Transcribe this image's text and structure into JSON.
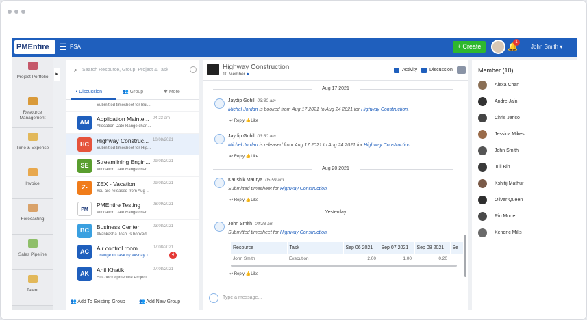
{
  "header": {
    "logo": "PMEntire",
    "module": "PSA",
    "create_label": "+ Create",
    "notification_count": "1",
    "user_name": "John Smith"
  },
  "nav": [
    {
      "label": "Project Portfolio"
    },
    {
      "label": "Resource Management"
    },
    {
      "label": "Time & Expense"
    },
    {
      "label": "Invoice"
    },
    {
      "label": "Forecasting"
    },
    {
      "label": "Sales Pipeline"
    },
    {
      "label": "Talent"
    }
  ],
  "list": {
    "search_placeholder": "Search Resource, Group, Project & Task",
    "tabs": [
      "Discussion",
      "Group",
      "More"
    ],
    "partial_preview": "Submitted timesheet for Bui...",
    "items": [
      {
        "initials": "AM",
        "name": "Application Mainte...",
        "date": "04:23 am",
        "preview": "Allocation Date Range chan...",
        "color": "#1f5fbd"
      },
      {
        "initials": "HC",
        "name": "Highway Construc...",
        "date": "10/08/2021",
        "preview": "Submitted timesheet for Hig...",
        "color": "#e5533c"
      },
      {
        "initials": "SE",
        "name": "Streamlining Engin...",
        "date": "09/08/2021",
        "preview": "Allocation Date Range chan...",
        "color": "#5a9e2f"
      },
      {
        "initials": "Z-",
        "name": "ZEX - Vacation",
        "date": "09/08/2021",
        "preview": "You are released from Aug ...",
        "color": "#f07c1a"
      },
      {
        "initials": "PM",
        "name": "PMEntire Testing",
        "date": "08/09/2021",
        "preview": "Allocation Date Range chan...",
        "color": "#1f3b7a"
      },
      {
        "initials": "BC",
        "name": "Business Center",
        "date": "03/08/2021",
        "preview": "Akankasha Joshi is booked ...",
        "color": "#3aa0e0"
      },
      {
        "initials": "AC",
        "name": "Air control room",
        "date": "07/08/2021",
        "preview": "Change In Task by Akshay T...",
        "color": "#1f5fbd",
        "badge": "4"
      },
      {
        "initials": "AK",
        "name": "Anil Khatik",
        "date": "07/08/2021",
        "preview": "Hi Check #pmentire Project ...",
        "color": "#1f5fbd"
      }
    ],
    "footer_add_existing": "Add To Existing Group",
    "footer_add_new": "Add New Group"
  },
  "chat": {
    "title": "Highway Construction",
    "subtitle": "10 Member",
    "activity_label": "Activity",
    "discussion_label": "Discussion",
    "top_date": "Aug 17 2021",
    "date2": "Aug 20 2021",
    "date3": "Yesterday",
    "messages": [
      {
        "name": "Jaydip Gohil",
        "time": "03:30 am",
        "who": "Michel Jordan",
        "mid": " is booked from Aug 17 2021 to Aug 24 2021 for ",
        "proj": "Highway Construction",
        "end": "."
      },
      {
        "name": "Jaydip Gohil",
        "time": "03:30 am",
        "who": "Michel Jordan",
        "mid": " is released from Aug 17 2021 to Aug 24 2021 for ",
        "proj": "Highway Construction",
        "end": "."
      },
      {
        "name": "Kaushik Maurya",
        "time": "05:59 am",
        "who": "",
        "mid": "Submitted timesheet for ",
        "proj": "Highway Construction",
        "end": "."
      },
      {
        "name": "John Smith",
        "time": "04:23 am",
        "who": "",
        "mid": "Submitted timesheet for ",
        "proj": "Highway Construction",
        "end": "."
      }
    ],
    "reply": "Reply",
    "like": "Like",
    "table": {
      "headers": [
        "Resource",
        "Task",
        "Sep 06 2021",
        "Sep 07 2021",
        "Sep 08 2021",
        "Se"
      ],
      "row": [
        "John Smith",
        "Execution",
        "2.00",
        "1.00",
        "0.20",
        ""
      ]
    },
    "composer_placeholder": "Type a message..."
  },
  "members": {
    "title": "Member (10)",
    "names": [
      "Alexa Chan",
      "Andre Jain",
      "Chris Jerico",
      "Jessica Mikes",
      "John Smith",
      "Juli Bin",
      "Kshitij Mathur",
      "Oliver Queen",
      "Rio Morte",
      "Xendric Mills"
    ]
  }
}
